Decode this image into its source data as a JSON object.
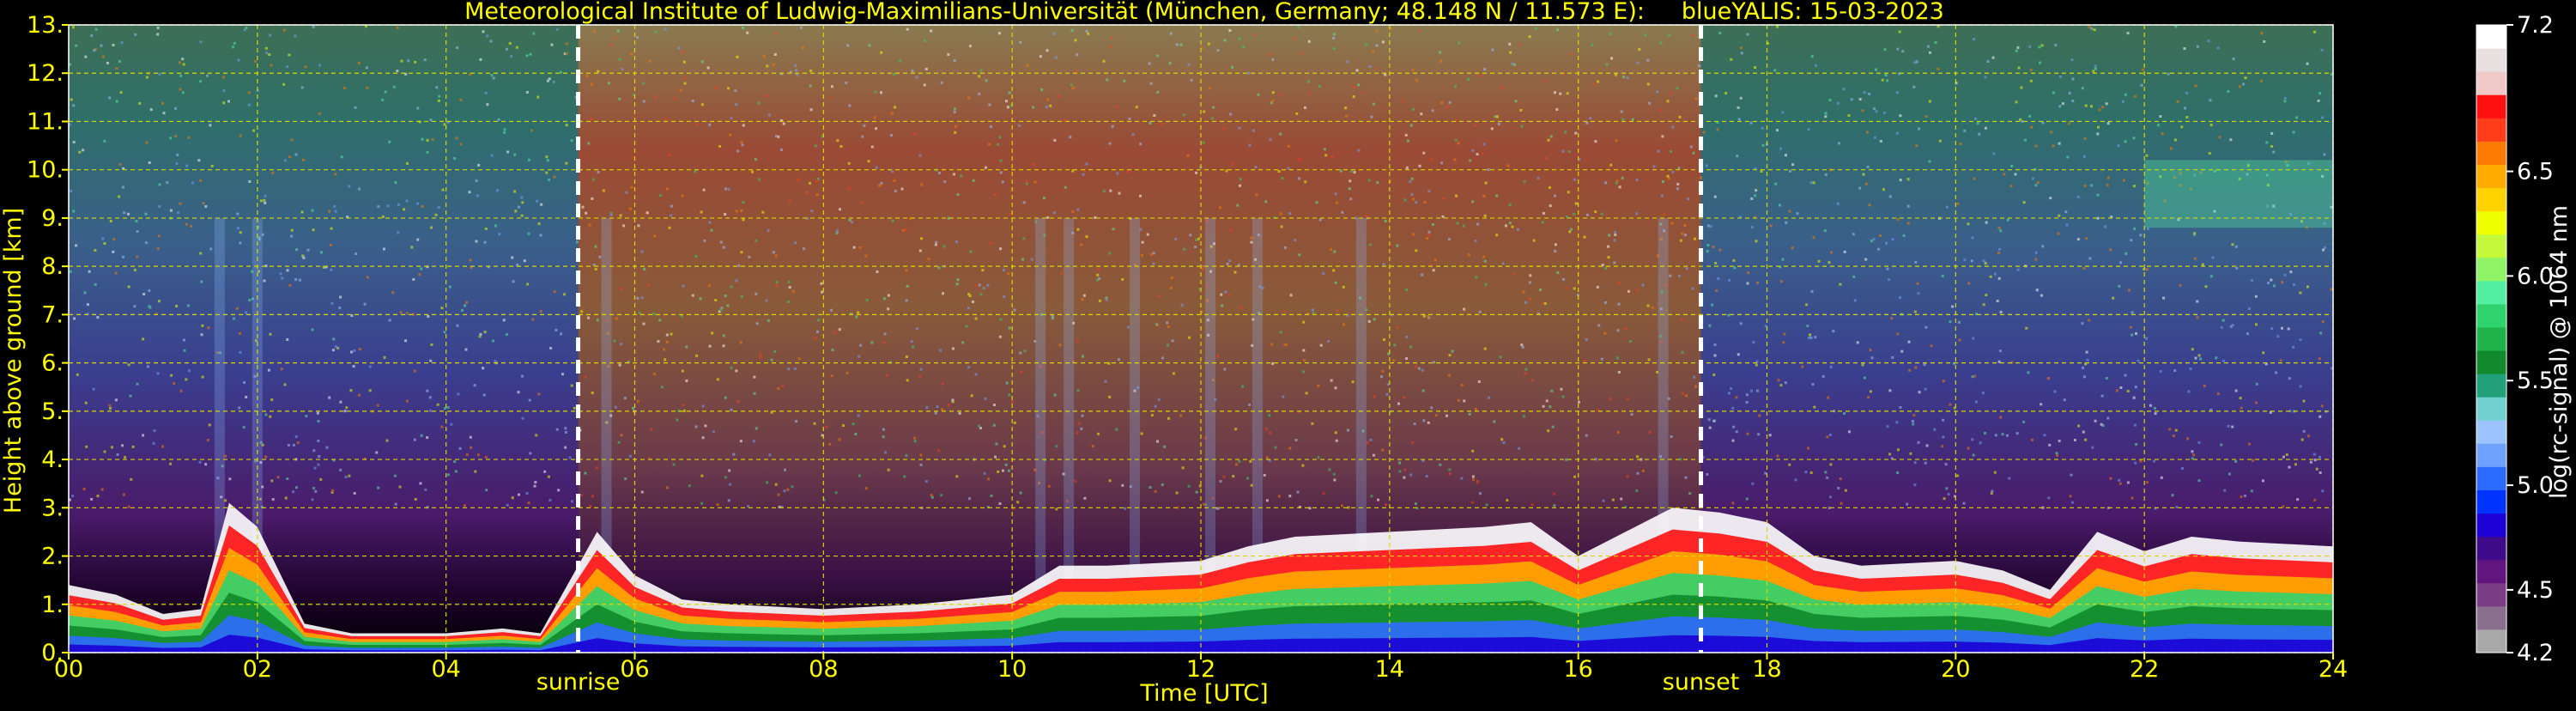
{
  "chart_data": {
    "type": "heatmap",
    "title": "Meteorological Institute of Ludwig-Maximilians-Universität (München, Germany; 48.148 N / 11.573 E):     blueYALIS: 15-03-2023",
    "xlabel": "Time [UTC]",
    "ylabel": "Height above ground [km]",
    "x_ticks": [
      "00",
      "02",
      "04",
      "06",
      "08",
      "10",
      "12",
      "14",
      "16",
      "18",
      "20",
      "22",
      "24"
    ],
    "x_tick_values": [
      0,
      2,
      4,
      6,
      8,
      10,
      12,
      14,
      16,
      18,
      20,
      22,
      24
    ],
    "y_ticks": [
      "0.",
      "1.",
      "2.",
      "3.",
      "4.",
      "5.",
      "6.",
      "7.",
      "8.",
      "9.",
      "10.",
      "11.",
      "12.",
      "13."
    ],
    "y_tick_values": [
      0,
      1,
      2,
      3,
      4,
      5,
      6,
      7,
      8,
      9,
      10,
      11,
      12,
      13
    ],
    "xlim": [
      0,
      24
    ],
    "ylim": [
      0,
      13
    ],
    "grid": true,
    "vlines": [
      {
        "label": "sunrise",
        "x": 5.4
      },
      {
        "label": "sunset",
        "x": 17.3
      }
    ],
    "colorbar": {
      "label": "log(rc-signal) @ 1064 nm",
      "range": [
        4.2,
        7.2
      ],
      "tick_labels": [
        "4.2",
        "4.5",
        "5.0",
        "5.5",
        "6.0",
        "6.5",
        "7.2"
      ],
      "tick_values": [
        4.2,
        4.5,
        5.0,
        5.5,
        6.0,
        6.5,
        7.2
      ]
    },
    "boundary_layer_top_km": {
      "x": [
        0,
        0.5,
        1,
        1.4,
        1.7,
        2,
        2.5,
        3,
        4,
        4.6,
        5,
        5.6,
        6,
        6.5,
        7,
        8,
        9,
        10,
        10.5,
        11,
        12,
        12.5,
        13,
        14,
        15,
        15.5,
        16,
        16.5,
        17,
        17.5,
        18,
        18.5,
        19,
        20,
        20.5,
        21,
        21.5,
        22,
        22.5,
        23,
        24
      ],
      "y": [
        1.4,
        1.2,
        0.8,
        0.9,
        3.1,
        2.6,
        0.6,
        0.4,
        0.4,
        0.5,
        0.4,
        2.5,
        1.6,
        1.1,
        1.0,
        0.9,
        1.0,
        1.2,
        1.8,
        1.8,
        1.9,
        2.2,
        2.4,
        2.5,
        2.6,
        2.7,
        2.0,
        2.5,
        3.0,
        2.9,
        2.7,
        2.0,
        1.8,
        1.9,
        1.7,
        1.3,
        2.5,
        2.1,
        2.4,
        2.3,
        2.2
      ]
    },
    "cirrus_layer": {
      "x_range": [
        22,
        24
      ],
      "y_range_km": [
        8.8,
        10.2
      ]
    },
    "cloud_columns_hours": [
      1.6,
      2.0,
      5.7,
      10.3,
      10.6,
      11.3,
      12.1,
      12.6,
      13.7,
      16.9
    ]
  },
  "colors": {
    "axis_text": "#ffff00",
    "grid": "#d8d800",
    "background": "#000000",
    "sun_line": "#ffffff",
    "colorbar_text": "#ffffff",
    "colorbar_scale": [
      "#a9a9a9",
      "#8b6f8f",
      "#7a3d86",
      "#62157f",
      "#3f0b8a",
      "#1c00d6",
      "#0033ff",
      "#2d6bff",
      "#6fa2ff",
      "#9cc4ff",
      "#71d1cf",
      "#22a07a",
      "#118a2c",
      "#1fb34a",
      "#2fd36d",
      "#54eea0",
      "#8ff566",
      "#c3f83b",
      "#f0ff00",
      "#ffd200",
      "#ffab00",
      "#ff7a00",
      "#ff3d1a",
      "#ff1010",
      "#f0c8c8",
      "#e8e0e0",
      "#ffffff"
    ]
  }
}
